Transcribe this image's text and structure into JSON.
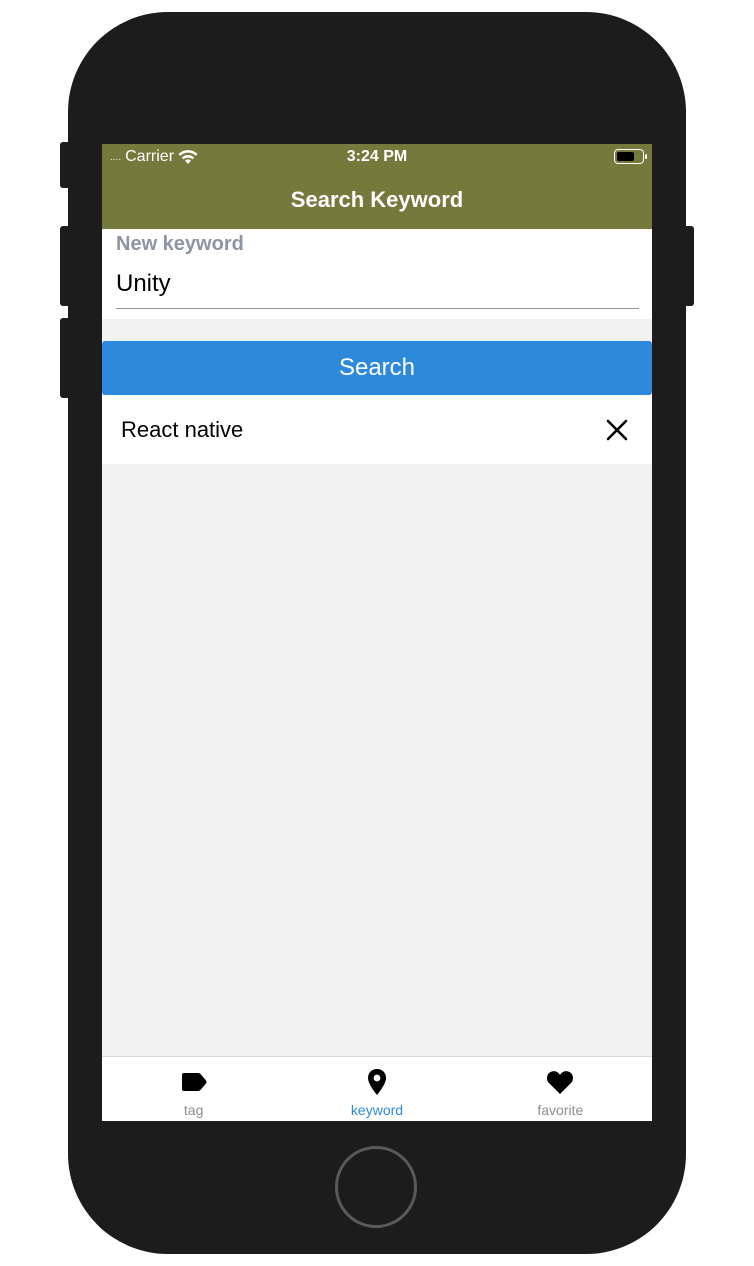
{
  "status_bar": {
    "signal": "....",
    "carrier": "Carrier",
    "time": "3:24 PM",
    "battery_level": 0.7
  },
  "nav": {
    "title": "Search Keyword"
  },
  "form": {
    "label": "New keyword",
    "value": "Unity"
  },
  "search_button": {
    "label": "Search"
  },
  "keywords": [
    {
      "label": "React native"
    }
  ],
  "tabs": [
    {
      "label": "tag",
      "icon": "tag-icon",
      "active": false
    },
    {
      "label": "keyword",
      "icon": "map-pin-icon",
      "active": true
    },
    {
      "label": "favorite",
      "icon": "heart-icon",
      "active": false
    }
  ],
  "colors": {
    "header_bg": "#747a3b",
    "search_button_bg": "#2d89dc",
    "tab_active": "#2d89dc",
    "tab_inactive": "#8e8e93"
  }
}
